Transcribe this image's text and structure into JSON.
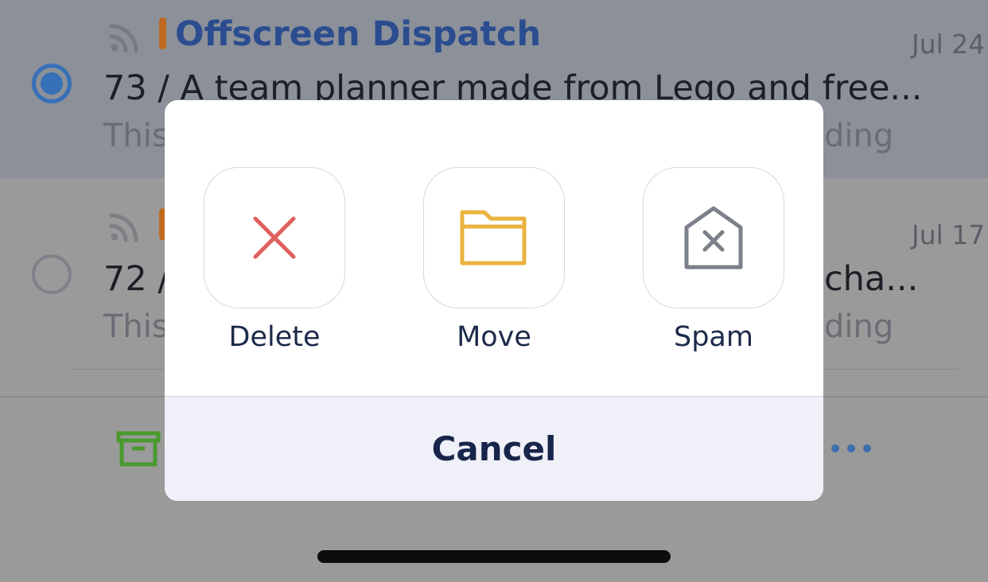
{
  "mail_list": {
    "items": [
      {
        "sender": "Offscreen Dispatch",
        "date": "Jul 24",
        "subject": "73 / A team planner made from Lego and free...",
        "preview_start": "This",
        "preview_end": "ding",
        "selected": true
      },
      {
        "date": "Jul 17",
        "subject_start": "72 /",
        "subject_end": "cha...",
        "preview_start": "This",
        "preview_end": "ding",
        "selected": false
      }
    ]
  },
  "action_sheet": {
    "actions": [
      {
        "label": "Delete",
        "icon": "x-icon",
        "color": "#e0605f"
      },
      {
        "label": "Move",
        "icon": "folder-icon",
        "color": "#eab33f"
      },
      {
        "label": "Spam",
        "icon": "spam-icon",
        "color": "#7b808a"
      }
    ],
    "cancel_label": "Cancel"
  },
  "toolbar": {
    "archive_icon": "archive-icon",
    "more_icon": "more-icon",
    "archive_color": "#4a9a2f",
    "more_color": "#3f6faf"
  },
  "colors": {
    "accent": "#2b4d8f",
    "tag": "#bf6a1f",
    "overlay": "#8b9099"
  }
}
